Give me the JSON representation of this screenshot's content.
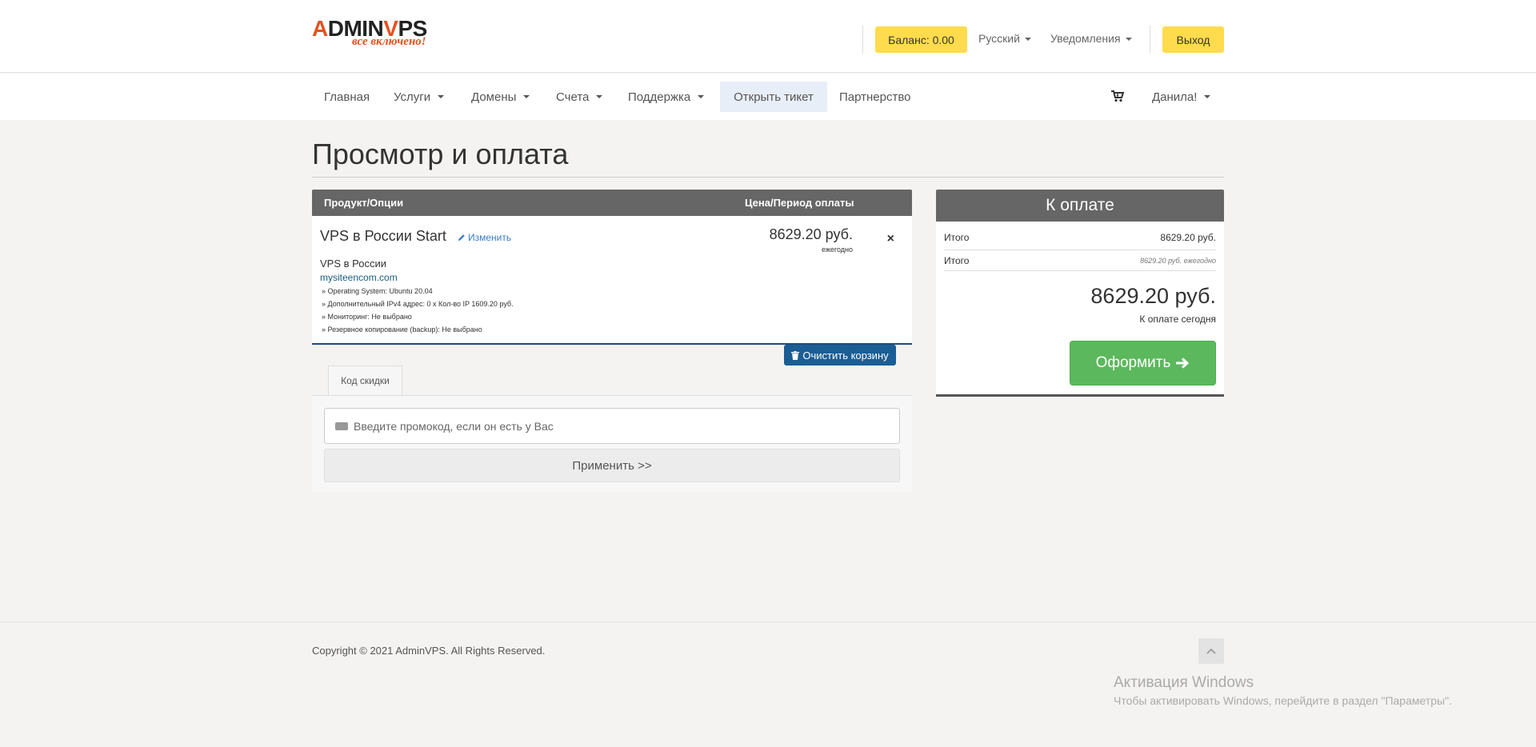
{
  "logo": {
    "text_a": "A",
    "text_dmin": "DMIN",
    "text_v": "V",
    "text_ps": "PS",
    "slogan": "все включено!"
  },
  "top_bar": {
    "balance_label": "Баланс: 0.00",
    "language_label": "Русский",
    "notifications_label": "Уведомления",
    "logout_label": "Выход"
  },
  "nav": {
    "items": [
      {
        "label": "Главная",
        "dropdown": false
      },
      {
        "label": "Услуги",
        "dropdown": true
      },
      {
        "label": "Домены",
        "dropdown": true
      },
      {
        "label": "Счета",
        "dropdown": true
      },
      {
        "label": "Поддержка",
        "dropdown": true
      },
      {
        "label": "Открыть тикет",
        "dropdown": false
      },
      {
        "label": "Партнерство",
        "dropdown": false
      }
    ],
    "user_label": "Данила!"
  },
  "page": {
    "title": "Просмотр и оплата"
  },
  "cart": {
    "col_product": "Продукт/Опции",
    "col_price": "Цена/Период оплаты",
    "item": {
      "name": "VPS в России Start",
      "edit_label": "Изменить",
      "group": "VPS в России",
      "domain": "mysiteencom.com",
      "options": [
        "» Operating System: Ubuntu 20.04",
        "» Дополнительный IPv4 адрес: 0 x Кол-во IP 1609.20 руб.",
        "» Мониторинг: Не выбрано",
        "» Резервное копирование (backup): Не выбрано"
      ],
      "price": "8629.20 руб.",
      "period": "ежегодно",
      "remove_label": "×"
    },
    "clear_label": "Очистить корзину"
  },
  "promo": {
    "tab_label": "Код скидки",
    "placeholder": "Введите промокод, если он есть у Вас",
    "apply_label": "Применить >>"
  },
  "summary": {
    "title": "К оплате",
    "subtotal_label": "Итого",
    "subtotal_value": "8629.20 руб.",
    "recurring_label": "Итого",
    "recurring_value": "8629.20 руб. ежегодно",
    "total": "8629.20 руб.",
    "due_today_label": "К оплате сегодня",
    "checkout_label": "Оформить"
  },
  "footer": {
    "copyright": "Copyright © 2021 AdminVPS. All Rights Reserved."
  },
  "windows_watermark": {
    "title": "Активация Windows",
    "subtitle": "Чтобы активировать Windows, перейдите в раздел \"Параметры\"."
  },
  "colors": {
    "brand": "#e8501e",
    "yellow": "#ffdb4d",
    "green": "#5cb85c",
    "dark_blue": "#1b5e94",
    "header_gray": "#666666"
  }
}
